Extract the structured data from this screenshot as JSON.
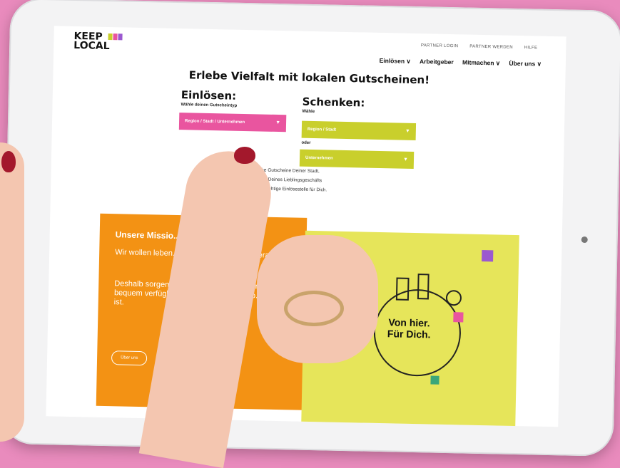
{
  "header": {
    "logo_line1": "KEEP",
    "logo_line2": "LOCAL",
    "top_links": [
      "PARTNER LOGIN",
      "PARTNER WERDEN",
      "HILFE"
    ],
    "nav": [
      "Einlösen ∨",
      "Arbeitgeber",
      "Mitmachen ∨",
      "Über uns ∨"
    ]
  },
  "hero": {
    "headline": "Erlebe Vielfalt mit lokalen Gutscheinen!",
    "einloesen_title": "Einlösen:",
    "einloesen_sub": "Wähle deinen Gutscheintyp",
    "einloesen_select": "Region / Stadt / Unternehmen",
    "schenken_title": "Schenken:",
    "schenken_sub": "Wähle",
    "schenken_select1": "Region / Stadt",
    "oder": "oder",
    "schenken_select2": "Unternehmen",
    "intro_lines": [
      "...rschenke Gutscheine Deiner Stadt,",
      "...gion oder Deines Lieblingsgeschäfts",
      "...finde die richtige Einlösestelle für Dich."
    ]
  },
  "mission": {
    "title": "Unsere Missio...",
    "p1": "Wir wollen leben... dte f... zukünftige Genera... ken.",
    "p2": "Deshalb sorgen w... lo... Gutscheine übera... nf... bequem verfügb... nur bei Gutschei... Co. der Fall ist.",
    "button": "Über uns"
  },
  "illustration": {
    "slogan_line1": "Von hier.",
    "slogan_line2": "Für Dich."
  },
  "colors": {
    "background": "#e98bbd",
    "pink": "#e9559f",
    "green": "#c9cf2c",
    "orange": "#f39214",
    "yellow": "#e6e55a"
  }
}
